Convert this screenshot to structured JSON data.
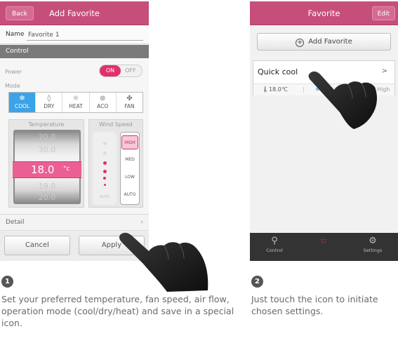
{
  "step1": {
    "number": "1",
    "description": "Set your preferred temperature, fan speed, air flow, operation mode (cool/dry/heat) and save in a special icon.",
    "screen": {
      "title": "Add Favorite",
      "back_label": "Back",
      "name_label": "Name",
      "name_value": "Favorite 1",
      "section_label": "Control",
      "power_label": "Power",
      "power_on_label": "ON",
      "power_off_label": "OFF",
      "power_state": "on",
      "mode_label": "Mode",
      "modes": [
        {
          "label": "COOL",
          "icon": "snowflake-icon",
          "active": true
        },
        {
          "label": "DRY",
          "icon": "droplet-icon",
          "active": false
        },
        {
          "label": "HEAT",
          "icon": "sun-icon",
          "active": false
        },
        {
          "label": "ACO",
          "icon": "auto-icon",
          "active": false
        },
        {
          "label": "FAN",
          "icon": "fan-icon",
          "active": false
        }
      ],
      "temperature_label": "Temperature",
      "temperature_value": "18.0",
      "temperature_unit": "°c",
      "temperature_above": [
        "20.0",
        "30.0"
      ],
      "temperature_below": [
        "19.0",
        "20.0"
      ],
      "wind_speed_label": "Wind Speed",
      "wind_levels": [
        "HIGH",
        "MED",
        "LOW",
        "AUTO"
      ],
      "wind_selected": "HIGH",
      "wind_auto_label": "AUTO",
      "detail_label": "Detail",
      "cancel_label": "Cancel",
      "apply_label": "Apply"
    }
  },
  "step2": {
    "number": "2",
    "description": "Just touch the icon to initiate chosen settings.",
    "screen": {
      "title": "Favorite",
      "edit_label": "Edit",
      "add_favorite_label": "Add Favorite",
      "favorite": {
        "name": "Quick cool",
        "temperature": "18.0℃",
        "wind": "High"
      },
      "nav": [
        {
          "label": "Control",
          "icon": "control-person-icon",
          "active": false
        },
        {
          "label": "",
          "icon": "star-icon",
          "active": true
        },
        {
          "label": "Settings",
          "icon": "gear-icon",
          "active": false
        }
      ]
    }
  },
  "colors": {
    "brand_pink": "#c64e7a",
    "accent_pink": "#e0306e",
    "mode_active_blue": "#3ba3e8",
    "nav_dark": "#333333"
  }
}
